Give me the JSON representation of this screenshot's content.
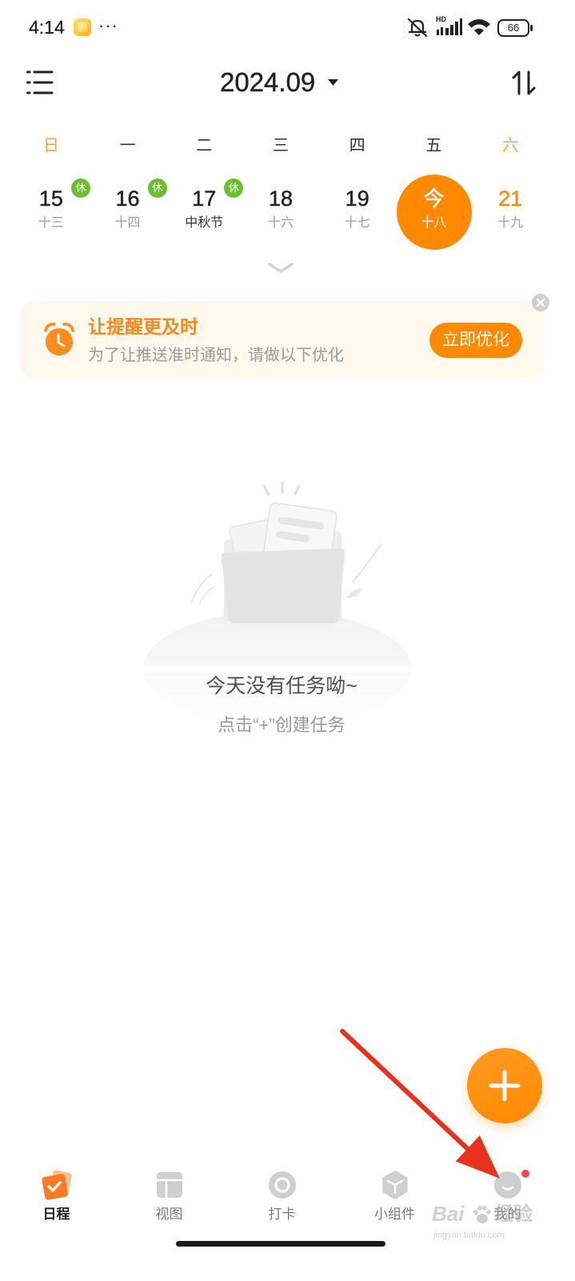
{
  "status_bar": {
    "time": "4:14",
    "more": "···",
    "network_label": "HD",
    "battery": "66",
    "icons": [
      "app-notification-icon",
      "mute-bell-icon",
      "signal-icon",
      "wifi-icon",
      "battery-icon"
    ]
  },
  "header": {
    "title": "2024.09",
    "menu_icon": "list-menu-icon",
    "dropdown_icon": "caret-down-icon",
    "sort_icon": "sort-icon"
  },
  "calendar": {
    "weekdays": [
      "日",
      "一",
      "二",
      "三",
      "四",
      "五",
      "六"
    ],
    "dates": [
      {
        "day": "15",
        "lunar": "十三",
        "badge": "休"
      },
      {
        "day": "16",
        "lunar": "十四",
        "badge": "休"
      },
      {
        "day": "17",
        "lunar": "中秋节",
        "badge": "休"
      },
      {
        "day": "18",
        "lunar": "十六"
      },
      {
        "day": "19",
        "lunar": "十七"
      },
      {
        "day": "今",
        "lunar": "十八",
        "selected": true
      },
      {
        "day": "21",
        "lunar": "十九",
        "weekend": true
      }
    ],
    "expand_icon": "chevron-down-icon"
  },
  "reminder_banner": {
    "title": "让提醒更及时",
    "subtitle": "为了让推送准时通知，请做以下优化",
    "button": "立即优化",
    "icon": "alarm-clock-icon",
    "close_icon": "close-icon"
  },
  "empty_state": {
    "title": "今天没有任务呦~",
    "hint": "点击“+”创建任务",
    "illustration": "empty-folder-illustration"
  },
  "fab": {
    "icon": "plus-icon"
  },
  "bottom_nav": [
    {
      "label": "日程",
      "icon": "schedule-check-icon",
      "active": true
    },
    {
      "label": "视图",
      "icon": "view-layout-icon",
      "active": false
    },
    {
      "label": "打卡",
      "icon": "check-in-icon",
      "active": false
    },
    {
      "label": "小组件",
      "icon": "widget-icon",
      "active": false
    },
    {
      "label": "我的",
      "icon": "profile-icon",
      "active": false,
      "badge_dot": true
    }
  ],
  "annotation": {
    "icon": "red-arrow-annotation"
  },
  "watermark": {
    "brand": "Bai",
    "suffix": "经验",
    "url": "jingyan.baidu.com"
  },
  "colors": {
    "accent": "#FF8A00",
    "weekend": "#F2A33A",
    "holiday_badge": "#6CBF2F",
    "banner_bg": "#FFF8ED",
    "banner_title": "#F5891F",
    "annotation_arrow": "#E8321E",
    "notification_dot": "#F2494C"
  }
}
